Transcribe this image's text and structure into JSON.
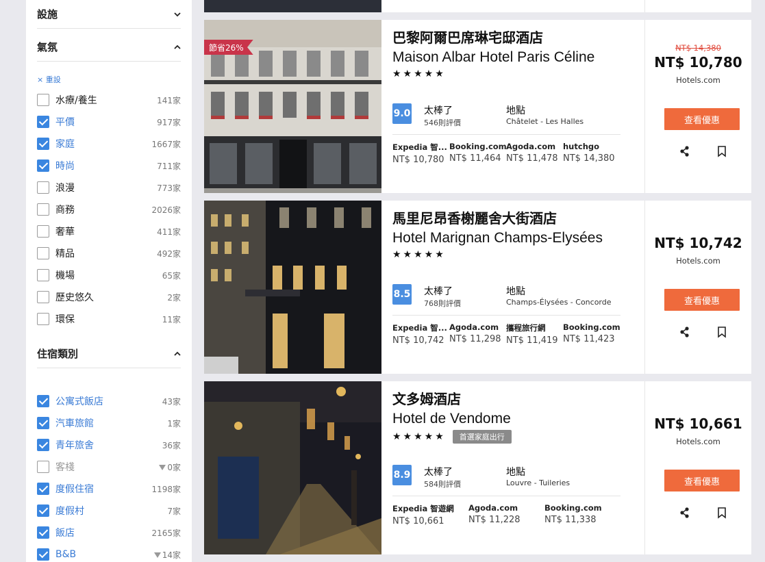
{
  "sidebar": {
    "facilities": {
      "title": "設施"
    },
    "atmosphere": {
      "title": "氣氛",
      "reset": "重設",
      "options": [
        {
          "label": "水療/養生",
          "count": "141家",
          "checked": false
        },
        {
          "label": "平價",
          "count": "917家",
          "checked": true
        },
        {
          "label": "家庭",
          "count": "1667家",
          "checked": true
        },
        {
          "label": "時尚",
          "count": "711家",
          "checked": true
        },
        {
          "label": "浪漫",
          "count": "773家",
          "checked": false
        },
        {
          "label": "商務",
          "count": "2026家",
          "checked": false
        },
        {
          "label": "奢華",
          "count": "411家",
          "checked": false
        },
        {
          "label": "精品",
          "count": "492家",
          "checked": false
        },
        {
          "label": "機場",
          "count": "65家",
          "checked": false
        },
        {
          "label": "歷史悠久",
          "count": "2家",
          "checked": false
        },
        {
          "label": "環保",
          "count": "11家",
          "checked": false
        }
      ]
    },
    "lodging": {
      "title": "住宿類別",
      "options": [
        {
          "label": "公寓式飯店",
          "count": "43家",
          "checked": true
        },
        {
          "label": "汽車旅館",
          "count": "1家",
          "checked": true
        },
        {
          "label": "青年旅舍",
          "count": "36家",
          "checked": true
        },
        {
          "label": "客棧",
          "count": "0家",
          "checked": false
        },
        {
          "label": "度假住宿",
          "count": "1198家",
          "checked": true
        },
        {
          "label": "度假村",
          "count": "7家",
          "checked": true
        },
        {
          "label": "飯店",
          "count": "2165家",
          "checked": true
        },
        {
          "label": "B&B",
          "count": "14家",
          "checked": true
        }
      ]
    }
  },
  "hotels": [
    {
      "name_zh": "巴黎阿爾巴席琳宅邸酒店",
      "name_en": "Maison Albar Hotel Paris Céline",
      "stars": "★★★★★",
      "discount": "節省26%",
      "score": "9.0",
      "rating_label": "太棒了",
      "reviews": "546則評價",
      "loc_label": "地點",
      "location": "Châtelet - Les Halles",
      "deals": [
        {
          "name": "Expedia 智...",
          "price": "NT$ 10,780"
        },
        {
          "name": "Booking.com",
          "price": "NT$ 11,464"
        },
        {
          "name": "Agoda.com",
          "price": "NT$ 11,478"
        },
        {
          "name": "hutchgo",
          "price": "NT$ 14,380"
        }
      ],
      "old_price": "NT$ 14,380",
      "price": "NT$ 10,780",
      "site": "Hotels.com",
      "cta": "查看優惠"
    },
    {
      "name_zh": "馬里尼昂香榭麗舍大街酒店",
      "name_en": "Hotel Marignan Champs-Elysées",
      "stars": "★★★★★",
      "score": "8.5",
      "rating_label": "太棒了",
      "reviews": "768則評價",
      "loc_label": "地點",
      "location": "Champs-Élysées - Concorde",
      "deals": [
        {
          "name": "Expedia 智...",
          "price": "NT$ 10,742"
        },
        {
          "name": "Agoda.com",
          "price": "NT$ 11,298"
        },
        {
          "name": "攜程旅行網",
          "price": "NT$ 11,419"
        },
        {
          "name": "Booking.com",
          "price": "NT$ 11,423"
        }
      ],
      "price": "NT$ 10,742",
      "site": "Hotels.com",
      "cta": "查看優惠"
    },
    {
      "name_zh": "文多姆酒店",
      "name_en": "Hotel de Vendome",
      "stars": "★★★★★",
      "tag": "首選家庭出行",
      "score": "8.9",
      "rating_label": "太棒了",
      "reviews": "584則評價",
      "loc_label": "地點",
      "location": "Louvre - Tuileries",
      "deals": [
        {
          "name": "Expedia 智遊網",
          "price": "NT$ 10,661"
        },
        {
          "name": "Agoda.com",
          "price": "NT$ 11,228"
        },
        {
          "name": "Booking.com",
          "price": "NT$ 11,338"
        }
      ],
      "price": "NT$ 10,661",
      "site": "Hotels.com",
      "cta": "查看優惠"
    }
  ]
}
